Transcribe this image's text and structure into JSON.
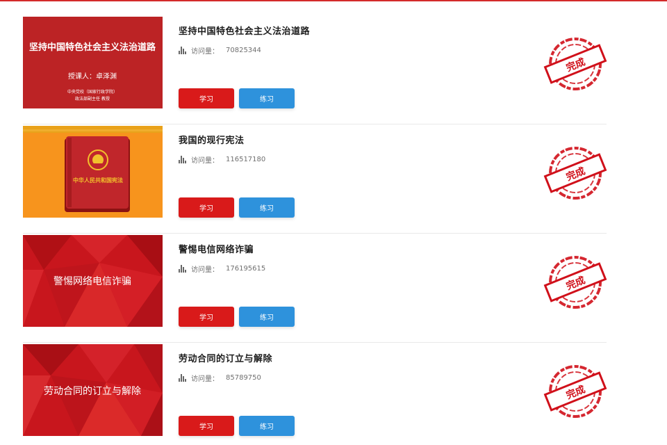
{
  "colors": {
    "accent_red": "#d91a1a",
    "accent_blue": "#2e92dc",
    "stamp_red": "#d0101a"
  },
  "items": [
    {
      "title": "坚持中国特色社会主义法治道路",
      "views_label": "访问量：",
      "views": "70825344",
      "study_label": "学习",
      "practice_label": "练习",
      "stamp_text": "完成",
      "thumb": {
        "title": "坚持中国特色社会主义法治道路",
        "lecturer": "授课人：卓泽渊",
        "org_line1": "中央党校（国家行政学院）",
        "org_line2": "政法部副主任  教授"
      }
    },
    {
      "title": "我国的现行宪法",
      "views_label": "访问量：",
      "views": "116517180",
      "study_label": "学习",
      "practice_label": "练习",
      "stamp_text": "完成",
      "thumb": {
        "book_title": "中华人民共和国宪法"
      }
    },
    {
      "title": "警惕电信网络诈骗",
      "views_label": "访问量：",
      "views": "176195615",
      "study_label": "学习",
      "practice_label": "练习",
      "stamp_text": "完成",
      "thumb": {
        "title": "警惕网络电信诈骗"
      }
    },
    {
      "title": "劳动合同的订立与解除",
      "views_label": "访问量：",
      "views": "85789750",
      "study_label": "学习",
      "practice_label": "练习",
      "stamp_text": "完成",
      "thumb": {
        "title": "劳动合同的订立与解除"
      }
    }
  ]
}
